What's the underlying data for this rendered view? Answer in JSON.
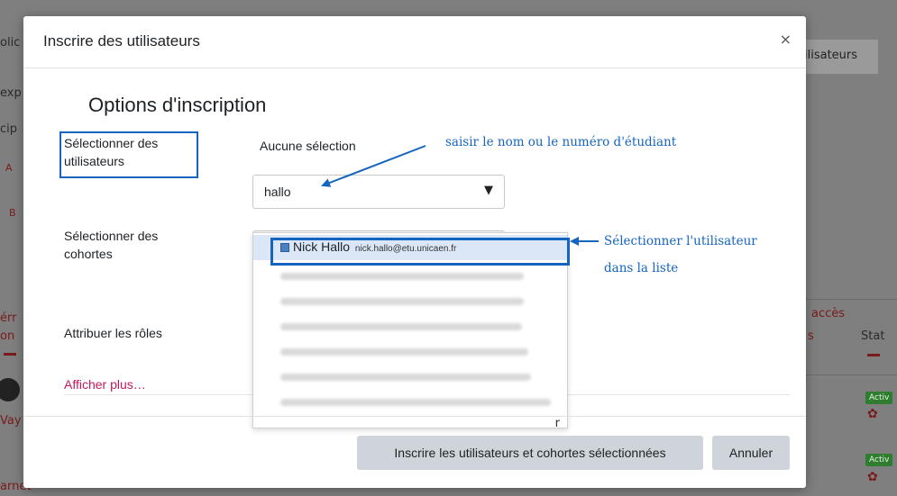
{
  "background": {
    "fragments": [
      "olic",
      "exp",
      "cip",
      "A",
      "B",
      "érr",
      "on",
      "Vay",
      "arnet",
      "accès",
      "s",
      "Stat"
    ],
    "header_button": "ilisateurs",
    "badges": [
      "Activ",
      "Activ"
    ]
  },
  "modal": {
    "title": "Inscrire des utilisateurs",
    "close": "×",
    "section_title": "Options d'inscription",
    "select_users_label": "Sélectionner des utilisateurs",
    "no_selection": "Aucune sélection",
    "search_value": "hallo",
    "search_caret": "▼",
    "select_cohorts_label": "Sélectionner des cohortes",
    "assign_roles_label": "Attribuer les rôles",
    "show_more": "Afficher plus…",
    "suggestions": [
      {
        "name": "Nick Hallo",
        "email": "nick.hallo@etu.unicaen.fr",
        "selected": true
      }
    ],
    "suggestion_tail": "r",
    "footer": {
      "enrol_button": "Inscrire les utilisateurs et cohortes sélectionnées",
      "cancel_button": "Annuler"
    }
  },
  "annotations": {
    "hint_search": "saisir le nom ou le numéro d'étudiant",
    "hint_select_line1": "Sélectionner l'utilisateur",
    "hint_select_line2": "dans la liste"
  },
  "colors": {
    "accent_annotation": "#1565c0",
    "link": "#c2185b",
    "button_bg": "#ced4da",
    "active_badge": "#2f7d2f"
  }
}
